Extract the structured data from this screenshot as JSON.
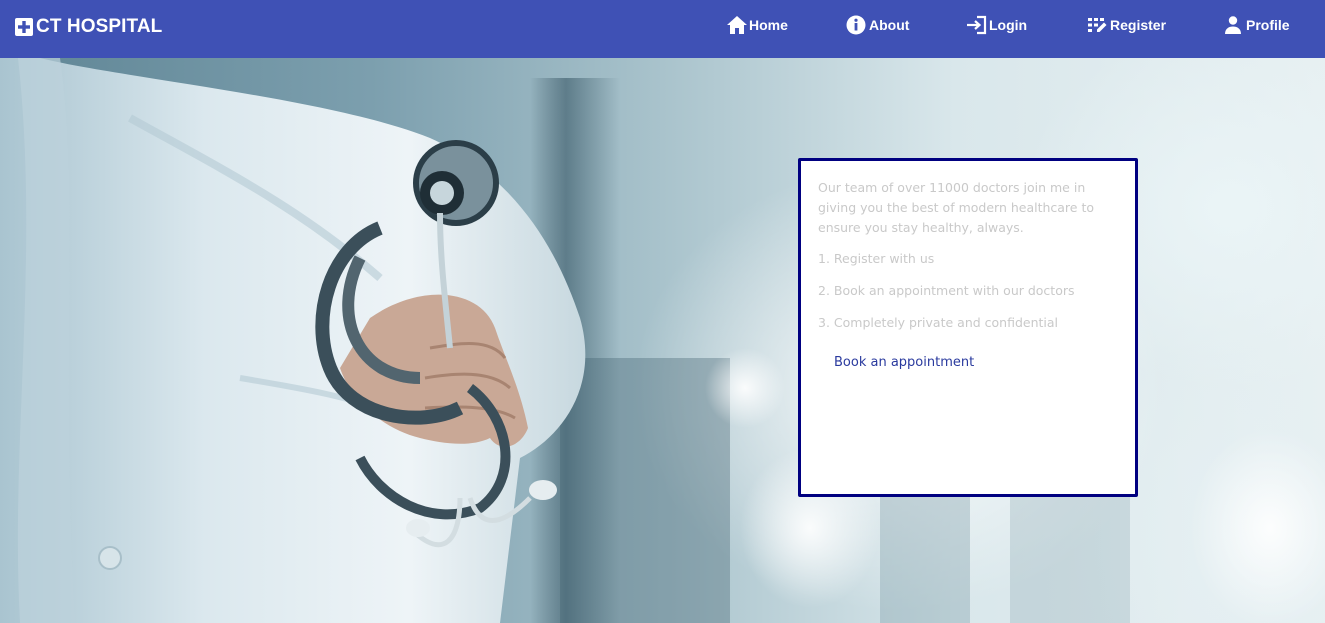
{
  "brand": {
    "title": "CT HOSPITAL",
    "icon": "medical-cross-icon"
  },
  "nav": {
    "home": {
      "label": "Home",
      "icon": "home-icon"
    },
    "about": {
      "label": "About",
      "icon": "info-icon"
    },
    "login": {
      "label": "Login",
      "icon": "login-icon"
    },
    "register": {
      "label": "Register",
      "icon": "register-icon"
    },
    "profile": {
      "label": "Profile",
      "icon": "person-icon"
    }
  },
  "card": {
    "intro": "Our team of over 11000 doctors join me in giving you the best of modern healthcare to ensure you stay healthy, always.",
    "steps": [
      "1. Register with us",
      "2. Book an appointment with our doctors",
      "3. Completely private and confidential"
    ],
    "cta": "Book an appointment"
  },
  "colors": {
    "navbar": "#3f51b5",
    "card_border": "#000080",
    "card_text": "#c9c9c9",
    "link": "#2a3a9e"
  }
}
